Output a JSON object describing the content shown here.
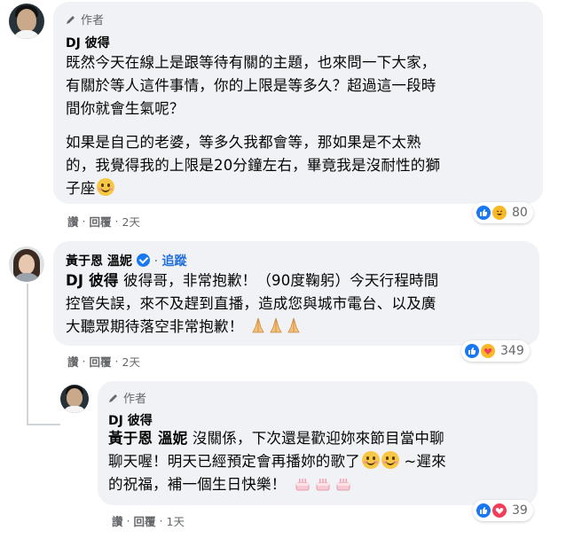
{
  "comments": [
    {
      "author_badge": "作者",
      "name": "DJ 彼得",
      "paragraphs": [
        "既然今天在線上是跟等待有關的主題，也來問一下大家，",
        "有關於等人這件事情，你的上限是等多久？超過這一段時",
        "間你就會生氣呢？"
      ],
      "paragraphs2": [
        "如果是自己的老婆，等多久我都會等，那如果是不太熟",
        "的，我覺得我的上限是20分鐘左右，畢竟我是沒耐性的獅",
        "子座"
      ],
      "actions": {
        "like": "讚",
        "sep": "·",
        "reply": "回覆",
        "time": "2天"
      },
      "reaction_count": "80",
      "reaction_icons": [
        "like-icon",
        "haha-icon"
      ]
    },
    {
      "name": "黃于恩 溫妮",
      "follow_label": "追蹤",
      "tag": "DJ 彼得",
      "lines": [
        " 彼得哥，非常抱歉！（90度鞠躬）今天行程時間",
        "控管失誤，來不及趕到直播，造成您與城市電台、以及廣",
        "大聽眾期待落空非常抱歉！"
      ],
      "actions": {
        "like": "讚",
        "sep": "·",
        "reply": "回覆",
        "time": "2天"
      },
      "reaction_count": "349",
      "reaction_icons": [
        "like-icon",
        "care-icon"
      ]
    },
    {
      "author_badge": "作者",
      "name": "DJ 彼得",
      "tag": "黃于恩 溫妮",
      "lines": [
        " 沒關係，下次還是歡迎妳來節目當中聊",
        "聊天喔！明天已經預定會再播妳的歌了",
        "的祝福，補一個生日快樂！"
      ],
      "line2_suffix": " ~遲來",
      "actions": {
        "like": "讚",
        "sep": "·",
        "reply": "回覆",
        "time": "1天"
      },
      "reaction_count": "39",
      "reaction_icons": [
        "like-icon",
        "love-icon"
      ]
    }
  ],
  "colors": {
    "bubble": "#f0f2f5",
    "link": "#216fdb",
    "like": "#1877f2",
    "meta": "#65676b"
  }
}
